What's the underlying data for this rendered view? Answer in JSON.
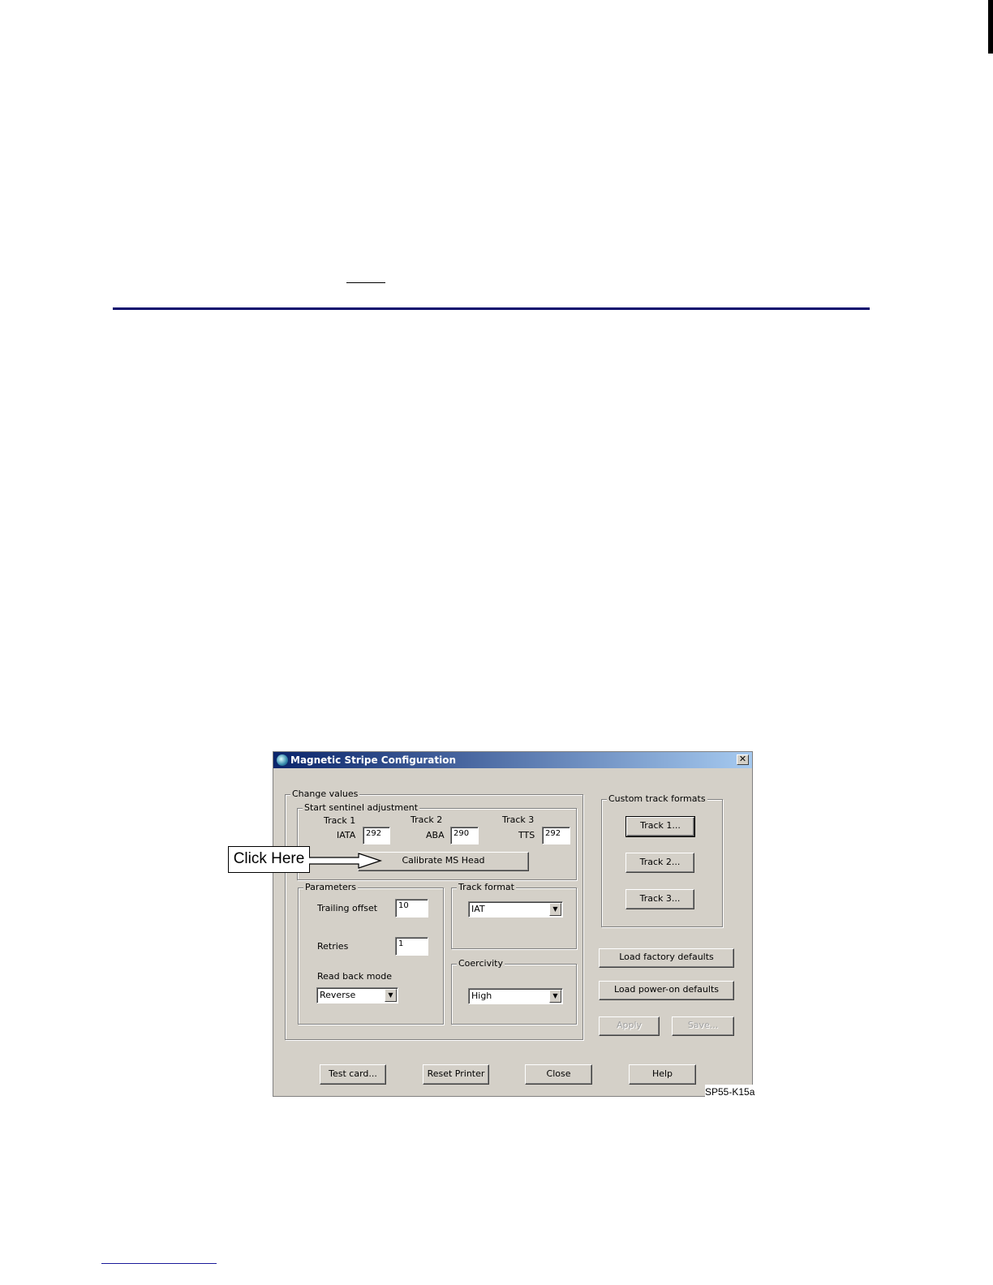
{
  "dialog": {
    "title": "Magnetic Stripe Configuration",
    "close_glyph": "✕",
    "change_values": {
      "legend": "Change values",
      "start_sentinel": {
        "legend": "Start sentinel adjustment",
        "tracks": [
          {
            "header": "Track 1",
            "label": "IATA",
            "value": "292"
          },
          {
            "header": "Track 2",
            "label": "ABA",
            "value": "290"
          },
          {
            "header": "Track 3",
            "label": "TTS",
            "value": "292"
          }
        ],
        "calibrate_button": "Calibrate MS Head"
      },
      "parameters": {
        "legend": "Parameters",
        "trailing_offset_label": "Trailing offset",
        "trailing_offset_value": "10",
        "retries_label": "Retries",
        "retries_value": "1",
        "read_back_mode_label": "Read back mode",
        "read_back_mode_value": "Reverse"
      },
      "track_format": {
        "legend": "Track format",
        "value": "IAT"
      },
      "coercivity": {
        "legend": "Coercivity",
        "value": "High"
      }
    },
    "custom_track_formats": {
      "legend": "Custom track formats",
      "buttons": [
        "Track 1...",
        "Track 2...",
        "Track 3..."
      ]
    },
    "side_buttons": {
      "load_factory": "Load factory defaults",
      "load_power_on": "Load power-on defaults",
      "apply": "Apply",
      "save": "Save..."
    },
    "bottom_buttons": {
      "test_card": "Test card...",
      "reset_printer": "Reset Printer",
      "close": "Close",
      "help": "Help"
    }
  },
  "callout": {
    "text": "Click Here"
  },
  "figure_id": "SP55-K15a",
  "colors": {
    "rule": "#0a0a6e",
    "titlebar_start": "#0a246a",
    "titlebar_end": "#a6caf0",
    "dialog_bg": "#d4d0c8"
  }
}
